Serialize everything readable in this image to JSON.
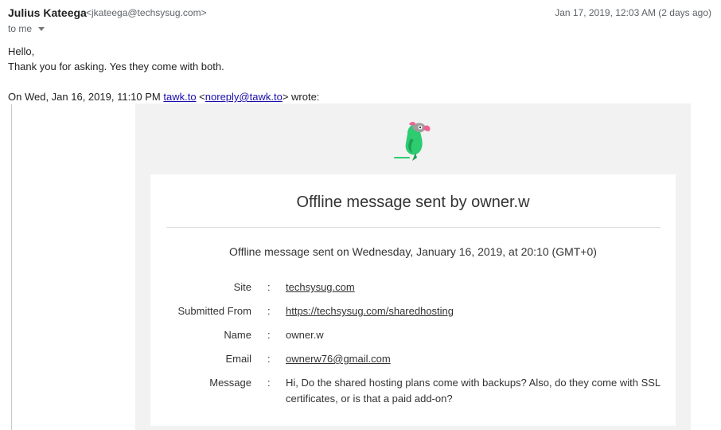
{
  "header": {
    "sender_name": "Julius Kateega",
    "sender_email": "<jkateega@techsysug.com>",
    "timestamp": "Jan 17, 2019, 12:03 AM (2 days ago)",
    "to_label": "to me"
  },
  "reply": {
    "greeting": "Hello,",
    "body": "Thank you for asking. Yes they come with both."
  },
  "quote": {
    "intro_prefix": "On Wed, Jan 16, 2019, 11:10 PM ",
    "sender_link": "tawk.to",
    "lt": " <",
    "email_link": "noreply@tawk.to",
    "suffix": "> wrote:"
  },
  "card": {
    "title": "Offline message sent by owner.w",
    "sent_on": "Offline message sent on Wednesday, January 16, 2019, at 20:10 (GMT+0)",
    "colon": ":",
    "fields": {
      "site": {
        "label": "Site",
        "value": "techsysug.com"
      },
      "submitted_from": {
        "label": "Submitted From",
        "value": "https://techsysug.com/sharedhosting"
      },
      "name": {
        "label": "Name",
        "value": "owner.w"
      },
      "email": {
        "label": "Email",
        "value": "ownerw76@gmail.com"
      },
      "message": {
        "label": "Message",
        "line1": "Hi, Do the shared hosting plans come with backups? Also, do they come with SSL",
        "line2": "certificates, or is that a paid add-on?"
      }
    }
  },
  "colors": {
    "link": "#1a0dab",
    "parrot_green": "#2ecc71",
    "parrot_pink": "#f06292"
  },
  "icons": {
    "logo": "tawk-parrot-logo",
    "dropdown": "chevron-down-icon"
  }
}
